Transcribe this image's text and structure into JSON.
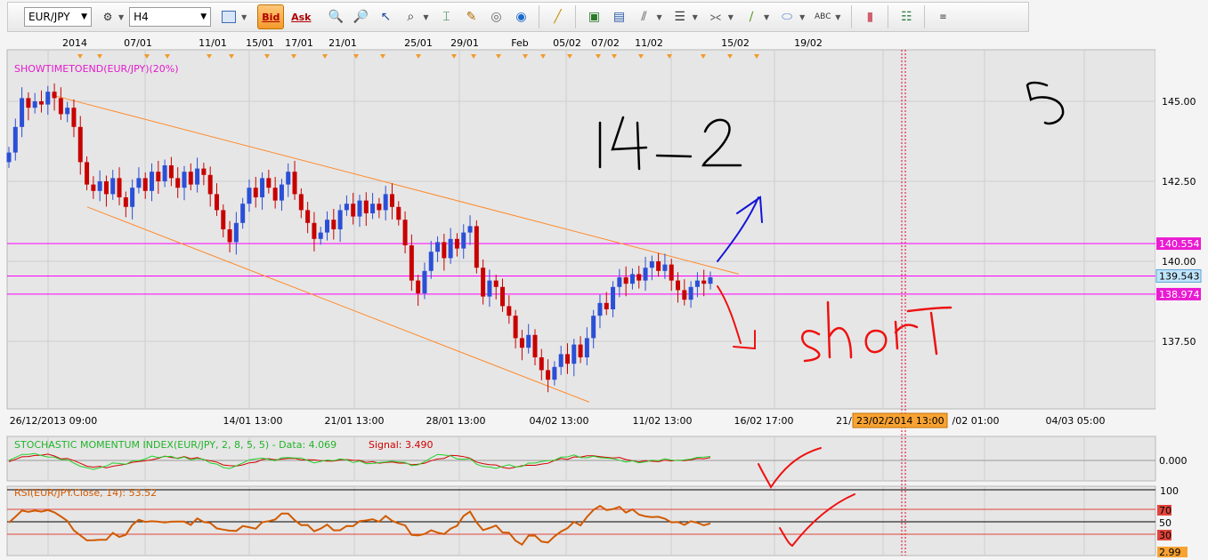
{
  "toolbar": {
    "symbol": "EUR/JPY",
    "timeframe": "H4",
    "bid_label": "Bid",
    "ask_label": "Ask"
  },
  "top_dates": [
    "2014",
    "07/01",
    "11/01",
    "15/01",
    "17/01",
    "21/01",
    "25/01",
    "29/01",
    "Feb",
    "05/02",
    "07/02",
    "11/02",
    "15/02",
    "19/02"
  ],
  "bottom_dates": [
    "26/12/2013 09:00",
    "14/01 13:00",
    "21/01 13:00",
    "28/01 13:00",
    "04/02 13:00",
    "11/02 13:00",
    "16/02 17:00",
    "21/",
    "/02 01:00",
    "04/03 05:00"
  ],
  "crosshair_date": "23/02/2014 13:00",
  "indicator_title": "SHOWTIMETOEND(EUR/JPY)(20%)",
  "price_axis": {
    "labels": [
      "145.00",
      "142.50",
      "140.00",
      "137.50"
    ],
    "marker_upper": "140.554",
    "marker_current": "139.543",
    "marker_lower": "138.974"
  },
  "stochastic": {
    "title": "STOCHASTIC MOMENTUM INDEX(EUR/JPY, 2, 8, 5, 5) -  Data: 4.069",
    "signal": "Signal: 3.490",
    "axis_label": "0.000"
  },
  "rsi": {
    "title": "RSI(EUR/JPY.Close, 14): 53.52",
    "levels": [
      "100",
      "70",
      "50",
      "30"
    ],
    "bottom_label": "2.99"
  },
  "annotations": {
    "top_label": "14-2",
    "corner_label": "5",
    "short_label": "short"
  },
  "colors": {
    "accent_orange": "#f39a2a",
    "bull_candle": "#2b4fd6",
    "bear_candle": "#c80000",
    "support_line": "#ff00ff",
    "trend_line": "#ff8a2a",
    "rsi_line": "#d15a00",
    "stoch_data": "#22d12a",
    "stoch_signal": "#d40000"
  },
  "chart_data": {
    "type": "candlestick",
    "symbol": "EUR/JPY",
    "timeframe": "H4",
    "close_series": [
      143.4,
      144.2,
      145.1,
      144.8,
      145.0,
      144.9,
      145.3,
      145.1,
      144.6,
      144.8,
      144.2,
      143.1,
      142.4,
      142.2,
      142.5,
      142.1,
      142.6,
      142.0,
      141.7,
      142.3,
      142.6,
      142.2,
      142.8,
      142.5,
      143.0,
      142.6,
      142.3,
      142.8,
      142.4,
      142.9,
      142.7,
      142.1,
      141.6,
      141.0,
      140.6,
      141.2,
      141.8,
      142.3,
      142.0,
      142.6,
      142.3,
      141.9,
      142.4,
      142.8,
      142.1,
      141.6,
      141.2,
      140.7,
      140.9,
      141.3,
      141.0,
      141.6,
      141.8,
      141.4,
      141.9,
      141.5,
      141.8,
      141.6,
      142.1,
      141.7,
      141.3,
      140.5,
      139.4,
      139.0,
      139.7,
      140.3,
      140.6,
      140.1,
      140.7,
      140.4,
      140.9,
      141.1,
      139.8,
      138.9,
      139.4,
      139.2,
      138.6,
      138.3,
      137.6,
      137.3,
      137.7,
      137.0,
      136.6,
      136.3,
      136.7,
      137.1,
      136.8,
      137.4,
      137.0,
      137.6,
      138.3,
      138.7,
      138.5,
      139.2,
      139.5,
      139.3,
      139.6,
      139.4,
      139.8,
      140.0,
      139.7,
      139.9,
      139.4,
      139.1,
      138.8,
      139.2,
      139.4,
      139.3,
      139.5
    ],
    "price_range": [
      135.5,
      146.5
    ],
    "trend_upper": {
      "from": 145.2,
      "to": 139.6
    },
    "trend_lower": {
      "from": 141.7,
      "to": 135.6
    },
    "horizontal_levels": [
      140.554,
      139.543,
      138.974
    ],
    "current_price": 139.543,
    "stochastic": {
      "data": 4.069,
      "signal": 3.49,
      "range": [
        -60,
        60
      ]
    },
    "rsi": {
      "value": 53.52,
      "levels": [
        70,
        50,
        30
      ],
      "range": [
        0,
        100
      ]
    }
  }
}
